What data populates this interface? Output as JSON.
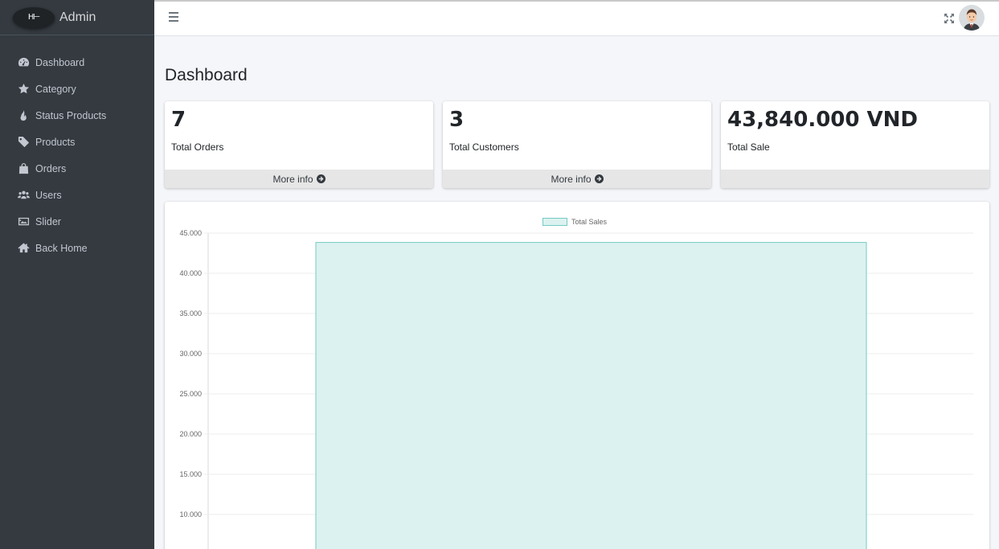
{
  "brand": {
    "logo_text": "H",
    "title": "Admin"
  },
  "sidebar": {
    "items": [
      {
        "label": "Dashboard",
        "icon": "dashboard-icon"
      },
      {
        "label": "Category",
        "icon": "star-icon"
      },
      {
        "label": "Status Products",
        "icon": "fire-icon"
      },
      {
        "label": "Products",
        "icon": "tag-icon"
      },
      {
        "label": "Orders",
        "icon": "bag-icon"
      },
      {
        "label": "Users",
        "icon": "users-icon"
      },
      {
        "label": "Slider",
        "icon": "image-icon"
      },
      {
        "label": "Back Home",
        "icon": "home-icon"
      }
    ]
  },
  "header": {
    "menu_icon": "hamburger-icon",
    "expand_icon": "fullscreen-icon",
    "avatar_icon": "user-avatar"
  },
  "page": {
    "title": "Dashboard"
  },
  "stats": [
    {
      "value": "7",
      "label": "Total Orders",
      "footer": "More info"
    },
    {
      "value": "3",
      "label": "Total Customers",
      "footer": "More info"
    },
    {
      "value": "43,840.000 VND",
      "label": "Total Sale",
      "footer": ""
    }
  ],
  "colors": {
    "sidebar_bg": "#343a40",
    "bar_fill": "#dbf2f0",
    "bar_border": "#75cac3"
  },
  "chart_data": {
    "type": "bar",
    "categories": [
      ""
    ],
    "series": [
      {
        "name": "Total Sales",
        "values": [
          43840
        ]
      }
    ],
    "yticks": [
      "45.000",
      "40.000",
      "35.000",
      "30.000",
      "25.000",
      "20.000",
      "15.000",
      "10.000"
    ],
    "ylim": [
      0,
      45000
    ],
    "grid": true,
    "legend": "top-center"
  }
}
